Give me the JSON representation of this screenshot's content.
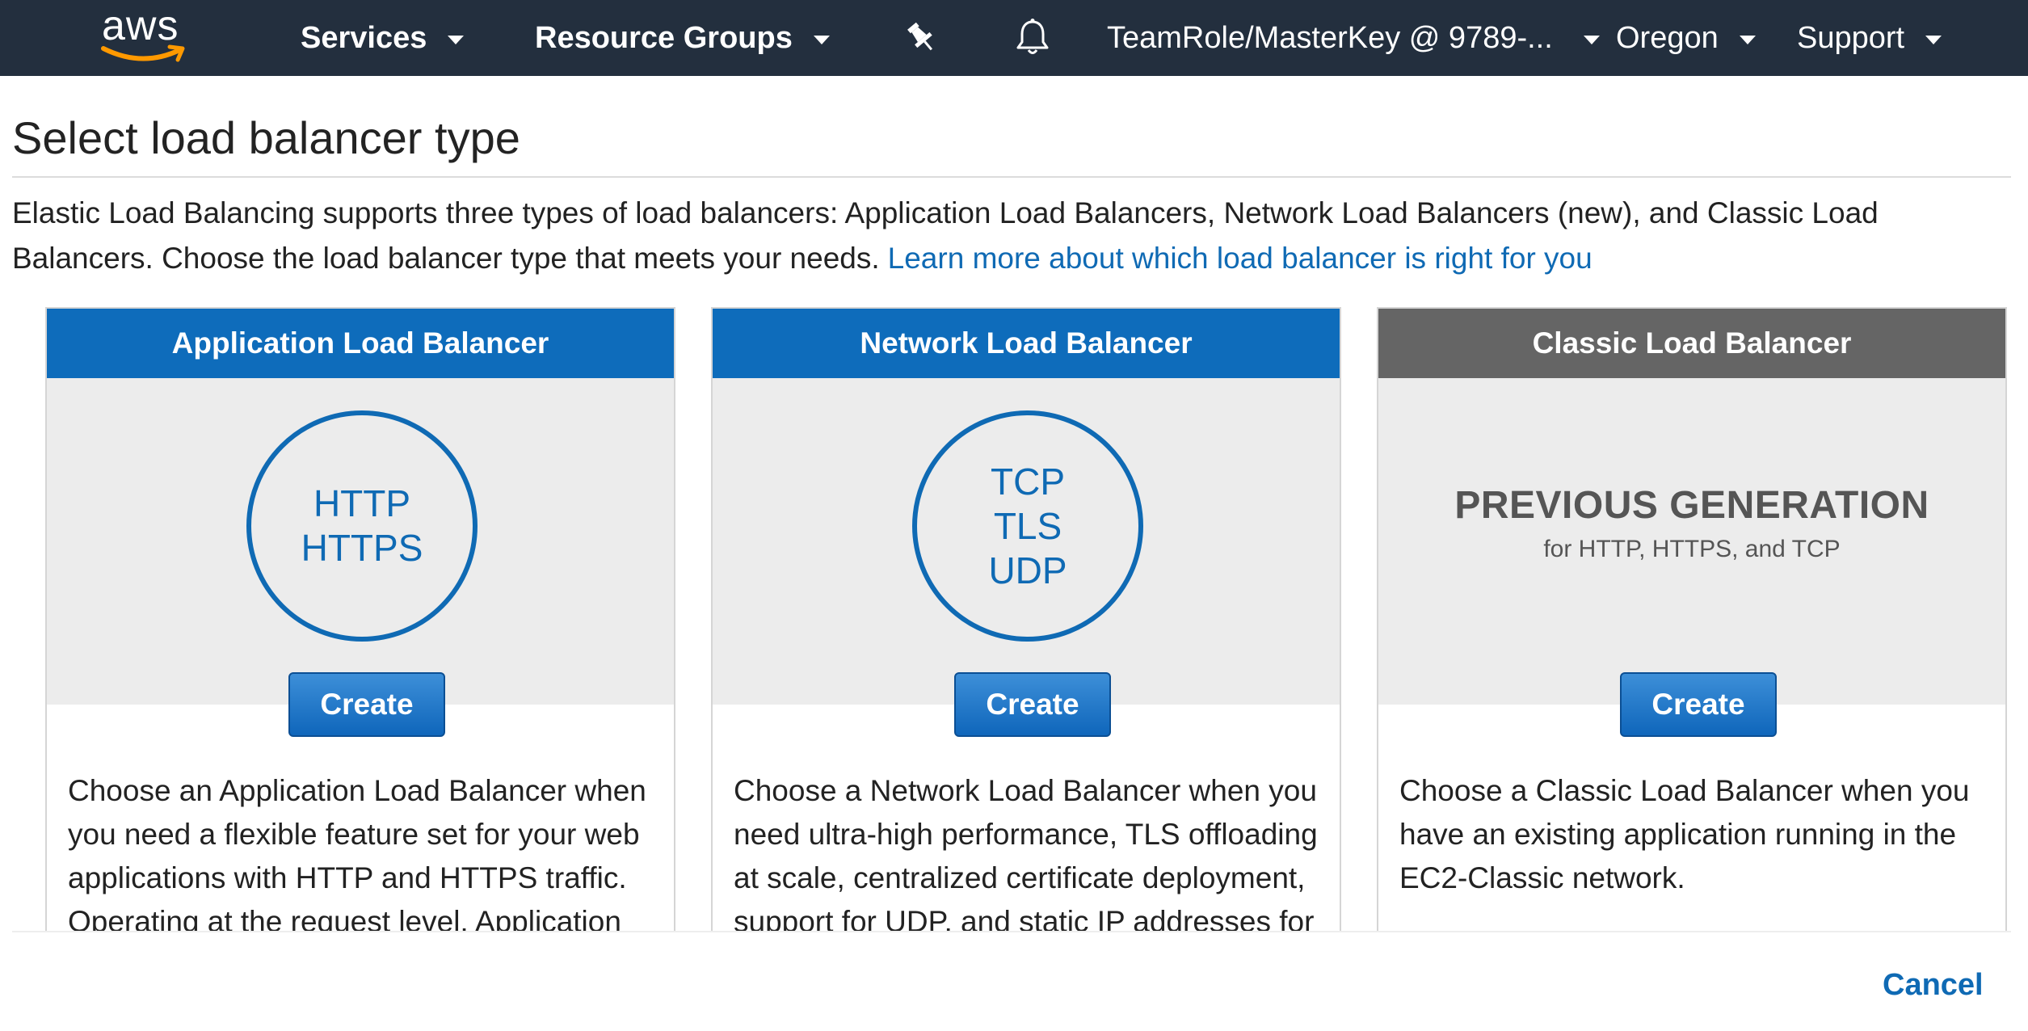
{
  "topnav": {
    "logo_text": "aws",
    "items": [
      {
        "label": "Services"
      },
      {
        "label": "Resource Groups"
      },
      {
        "label": "TeamRole/MasterKey @ 9789-..."
      },
      {
        "label": "Oregon"
      },
      {
        "label": "Support"
      }
    ],
    "icons": [
      "pin-icon",
      "bell-icon"
    ]
  },
  "page": {
    "title": "Select load balancer type",
    "intro": "Elastic Load Balancing supports three types of load balancers: Application Load Balancers, Network Load Balancers (new), and Classic Load Balancers. Choose the load balancer type that meets your needs.",
    "learn_more": "Learn more about which load balancer is right for you"
  },
  "cards": [
    {
      "title": "Application Load Balancer",
      "protocols": [
        "HTTP",
        "HTTPS"
      ],
      "create_label": "Create",
      "description": "Choose an Application Load Balancer when you need a flexible feature set for your web applications with HTTP and HTTPS traffic. Operating at the request level, Application"
    },
    {
      "title": "Network Load Balancer",
      "protocols": [
        "TCP",
        "TLS",
        "UDP"
      ],
      "create_label": "Create",
      "description": "Choose a Network Load Balancer when you need ultra-high performance, TLS offloading at scale, centralized certificate deployment, support for UDP, and static IP addresses for"
    },
    {
      "title": "Classic Load Balancer",
      "graphic_title": "PREVIOUS GENERATION",
      "graphic_subtitle": "for HTTP, HTTPS, and TCP",
      "create_label": "Create",
      "description": "Choose a Classic Load Balancer when you have an existing application running in the EC2-Classic network."
    }
  ],
  "footer": {
    "cancel_label": "Cancel"
  },
  "colors": {
    "nav_bg": "#232f3e",
    "brand_orange": "#ff9900",
    "card_header_blue": "#0e6cbb",
    "card_header_grey": "#656565",
    "link_blue": "#0f6ab4"
  }
}
